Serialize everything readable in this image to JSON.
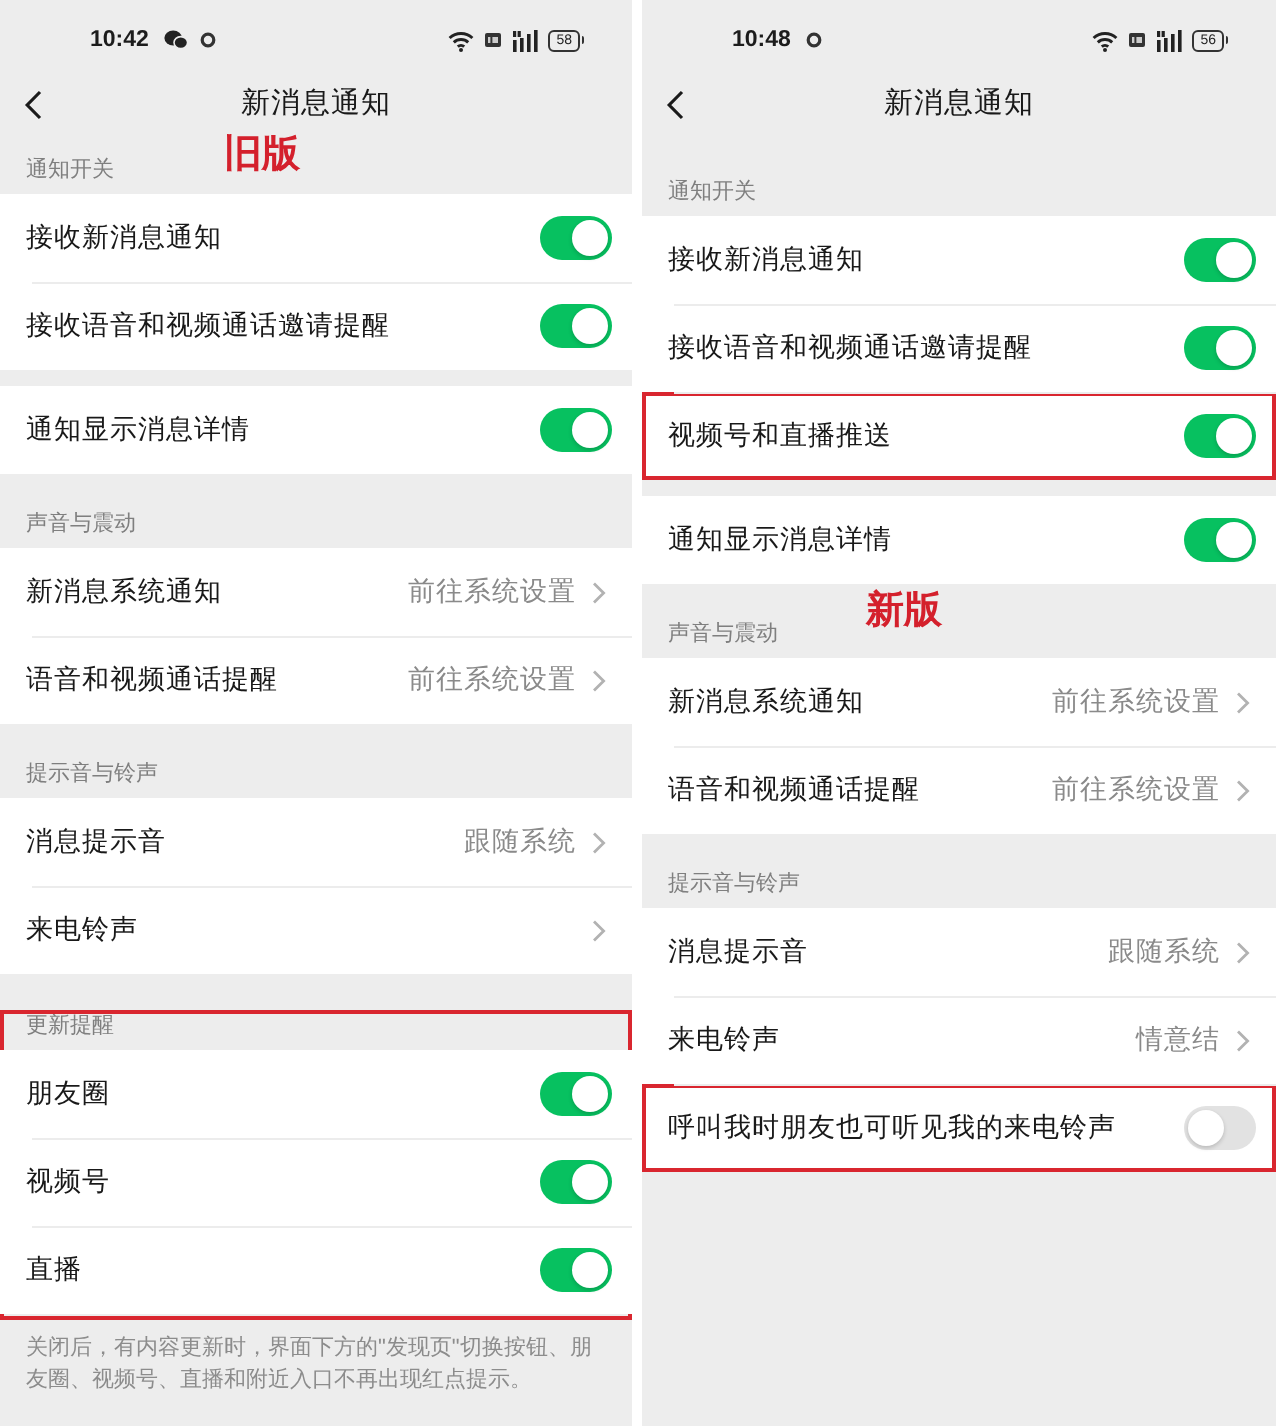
{
  "panels": [
    {
      "status_bar": {
        "time": "10:42",
        "notification_icons": [
          {
            "kind": "chat"
          },
          {
            "kind": "ring"
          }
        ],
        "battery": "58"
      },
      "nav_bar": {
        "title": "新消息通知"
      },
      "sections": [
        {
          "header": "通知开关",
          "annotation": "旧版",
          "highlighted": false,
          "cards": [
            {
              "rows": [
                {
                  "kind": "toggle",
                  "label": "接收新消息通知",
                  "on": true,
                  "highlighted": false
                },
                {
                  "kind": "toggle",
                  "label": "接收语音和视频通话邀请提醒",
                  "on": true,
                  "highlighted": false
                }
              ]
            },
            {
              "rows": [
                {
                  "kind": "toggle",
                  "label": "通知显示消息详情",
                  "on": true,
                  "highlighted": false
                }
              ]
            }
          ]
        },
        {
          "header": "声音与震动",
          "highlighted": false,
          "cards": [
            {
              "rows": [
                {
                  "kind": "link",
                  "label": "新消息系统通知",
                  "value": "前往系统设置",
                  "highlighted": false
                },
                {
                  "kind": "link",
                  "label": "语音和视频通话提醒",
                  "value": "前往系统设置",
                  "highlighted": false
                }
              ]
            }
          ]
        },
        {
          "header": "提示音与铃声",
          "highlighted": false,
          "cards": [
            {
              "rows": [
                {
                  "kind": "link",
                  "label": "消息提示音",
                  "value": "跟随系统",
                  "highlighted": false
                },
                {
                  "kind": "link",
                  "label": "来电铃声",
                  "highlighted": false
                }
              ]
            }
          ]
        },
        {
          "header": "更新提醒",
          "highlighted": true,
          "cards": [
            {
              "rows": [
                {
                  "kind": "toggle",
                  "label": "朋友圈",
                  "on": true,
                  "highlighted": false
                },
                {
                  "kind": "toggle",
                  "label": "视频号",
                  "on": true,
                  "highlighted": false
                },
                {
                  "kind": "toggle",
                  "label": "直播",
                  "on": true,
                  "highlighted": false
                }
              ]
            }
          ],
          "footer": "关闭后，有内容更新时，界面下方的\"发现页\"切换按钮、朋友圈、视频号、直播和附近入口不再出现红点提示。"
        }
      ]
    },
    {
      "status_bar": {
        "time": "10:48",
        "notification_icons": [
          {
            "kind": "ring"
          }
        ],
        "battery": "56"
      },
      "nav_bar": {
        "title": "新消息通知"
      },
      "sections": [
        {
          "header": "通知开关",
          "highlighted": false,
          "cards": [
            {
              "rows": [
                {
                  "kind": "toggle",
                  "label": "接收新消息通知",
                  "on": true,
                  "highlighted": false
                },
                {
                  "kind": "toggle",
                  "label": "接收语音和视频通话邀请提醒",
                  "on": true,
                  "highlighted": false
                },
                {
                  "kind": "toggle",
                  "label": "视频号和直播推送",
                  "on": true,
                  "highlighted": true
                }
              ]
            },
            {
              "rows": [
                {
                  "kind": "toggle",
                  "label": "通知显示消息详情",
                  "on": true,
                  "highlighted": false
                }
              ]
            }
          ]
        },
        {
          "header": "声音与震动",
          "annotation": "新版",
          "highlighted": false,
          "cards": [
            {
              "rows": [
                {
                  "kind": "link",
                  "label": "新消息系统通知",
                  "value": "前往系统设置",
                  "highlighted": false
                },
                {
                  "kind": "link",
                  "label": "语音和视频通话提醒",
                  "value": "前往系统设置",
                  "highlighted": false
                }
              ]
            }
          ]
        },
        {
          "header": "提示音与铃声",
          "highlighted": false,
          "cards": [
            {
              "rows": [
                {
                  "kind": "link",
                  "label": "消息提示音",
                  "value": "跟随系统",
                  "highlighted": false
                },
                {
                  "kind": "link",
                  "label": "来电铃声",
                  "value": "情意结",
                  "highlighted": false
                },
                {
                  "kind": "toggle",
                  "label": "呼叫我时朋友也可听见我的来电铃声",
                  "on": false,
                  "highlighted": true
                }
              ]
            }
          ]
        }
      ]
    }
  ]
}
